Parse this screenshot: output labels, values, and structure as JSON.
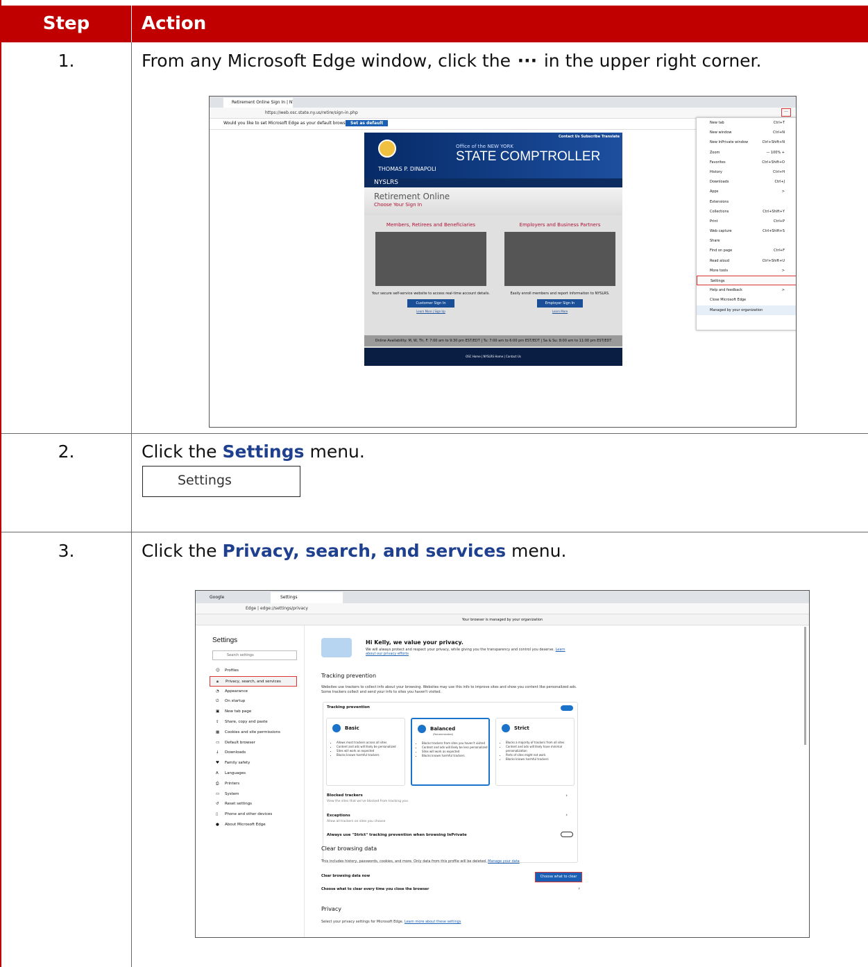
{
  "table": {
    "header_step": "Step",
    "header_action": "Action",
    "accent_color": "#c00000",
    "rows": [
      {
        "num": "1.",
        "pre": "From any Microsoft Edge window, click the ",
        "ellipsis": "···",
        "post": " in the upper right corner."
      },
      {
        "num": "2.",
        "pre": "Click the ",
        "bold": "Settings",
        "post": " menu."
      },
      {
        "num": "3.",
        "pre": "Click the ",
        "bold": "Privacy, search, and services",
        "post": " menu."
      }
    ]
  },
  "shot1": {
    "tab_title": "Retirement Online Sign In | NYSL",
    "url": "https://web.osc.state.ny.us/retire/sign-in.php",
    "info_msg": "Would you like to set Microsoft Edge as your default browser?",
    "info_btn": "Set as default",
    "site": {
      "toplinks": "Contact Us   Subscribe   Translate",
      "office": "Office of the NEW YORK",
      "title": "STATE COMPTROLLER",
      "name": "THOMAS P. DINAPOLI",
      "nysbar": "NYSLRS",
      "ro_title": "Retirement Online",
      "ro_sub": "Choose Your Sign In",
      "col1_head": "Members, Retirees and Beneficiaries",
      "col1_desc": "Your secure self-service website to access real-time account details.",
      "col1_btn": "Customer Sign In",
      "col1_link": "Learn More | Sign Up",
      "col2_head": "Employers and Business Partners",
      "col2_desc": "Easily enroll members and report information to NYSLRS.",
      "col2_btn": "Employer Sign In",
      "col2_link": "Learn More",
      "avail": "Online Availability: M, W, Th, F: 7:00 am to 9:30 pm EST/EDT | Tu: 7:00 am to 6:00 pm EST/EDT | Sa & Su: 8:00 am to 11:00 pm EST/EDT",
      "footer": "OSC Home | NYSLRS Home | Contact Us"
    },
    "menu": [
      {
        "label": "New tab",
        "sc": "Ctrl+T"
      },
      {
        "label": "New window",
        "sc": "Ctrl+N"
      },
      {
        "label": "New InPrivate window",
        "sc": "Ctrl+Shift+N"
      },
      {
        "label": "Zoom",
        "sc": "—  100%  +"
      },
      {
        "label": "Favorites",
        "sc": "Ctrl+Shift+O"
      },
      {
        "label": "History",
        "sc": "Ctrl+H"
      },
      {
        "label": "Downloads",
        "sc": "Ctrl+J"
      },
      {
        "label": "Apps",
        "sc": ">"
      },
      {
        "label": "Extensions",
        "sc": ""
      },
      {
        "label": "Collections",
        "sc": "Ctrl+Shift+Y"
      },
      {
        "label": "Print",
        "sc": "Ctrl+P"
      },
      {
        "label": "Web capture",
        "sc": "Ctrl+Shift+S"
      },
      {
        "label": "Share",
        "sc": ""
      },
      {
        "label": "Find on page",
        "sc": "Ctrl+F"
      },
      {
        "label": "Read aloud",
        "sc": "Ctrl+Shift+U"
      },
      {
        "label": "More tools",
        "sc": ">"
      },
      {
        "label": "Settings",
        "sc": ""
      },
      {
        "label": "Help and feedback",
        "sc": ">"
      },
      {
        "label": "Close Microsoft Edge",
        "sc": ""
      },
      {
        "label": "Managed by your organization",
        "sc": ""
      }
    ]
  },
  "settings_box": "Settings",
  "shot2": {
    "tab1": "Google",
    "tab2": "Settings",
    "url_prefix": "Edge",
    "url": "edge://settings/privacy",
    "managed": "Your browser is managed by your organization",
    "side_title": "Settings",
    "search_ph": "Search settings",
    "side_items": [
      "Profiles",
      "Privacy, search, and services",
      "Appearance",
      "On startup",
      "New tab page",
      "Share, copy and paste",
      "Cookies and site permissions",
      "Default browser",
      "Downloads",
      "Family safety",
      "Languages",
      "Printers",
      "System",
      "Reset settings",
      "Phone and other devices",
      "About Microsoft Edge"
    ],
    "hero_title": "Hi Kelly, we value your privacy.",
    "hero_sub": "We will always protect and respect your privacy, while giving you the transparency and control you deserve.",
    "hero_link": "Learn about our privacy efforts",
    "tp_title": "Tracking prevention",
    "tp_desc": "Websites use trackers to collect info about your browsing. Websites may use this info to improve sites and show you content like personalized ads. Some trackers collect and send your info to sites you haven't visited.",
    "tp_label": "Tracking prevention",
    "levels": [
      {
        "name": "Basic",
        "rec": "",
        "items": [
          "Allows most trackers across all sites",
          "Content and ads will likely be personalized",
          "Sites will work as expected",
          "Blocks known harmful trackers"
        ]
      },
      {
        "name": "Balanced",
        "rec": "(Recommended)",
        "items": [
          "Blocks trackers from sites you haven't visited",
          "Content and ads will likely be less personalized",
          "Sites will work as expected",
          "Blocks known harmful trackers"
        ]
      },
      {
        "name": "Strict",
        "rec": "",
        "items": [
          "Blocks a majority of trackers from all sites",
          "Content and ads will likely have minimal personalization",
          "Parts of sites might not work",
          "Blocks known harmful trackers"
        ]
      }
    ],
    "blocked": "Blocked trackers",
    "blocked_sub": "View the sites that we've blocked from tracking you",
    "exceptions": "Exceptions",
    "exceptions_sub": "Allow all trackers on sites you choose",
    "strict_inprivate": "Always use \"Strict\" tracking prevention when browsing InPrivate",
    "cbd_title": "Clear browsing data",
    "cbd_desc": "This includes history, passwords, cookies, and more. Only data from this profile will be deleted.",
    "cbd_link": "Manage your data",
    "cbd_now": "Clear browsing data now",
    "cbd_btn": "Choose what to clear",
    "cbd_every": "Choose what to clear every time you close the browser",
    "priv_title": "Privacy",
    "priv_desc": "Select your privacy settings for Microsoft Edge.",
    "priv_link": "Learn more about these settings"
  }
}
